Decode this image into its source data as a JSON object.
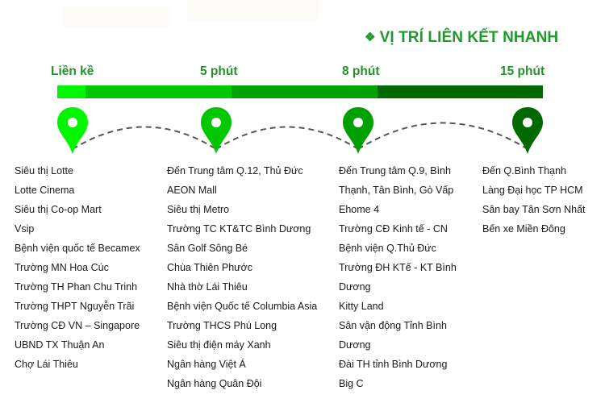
{
  "title": {
    "bullet": "❖",
    "text": "VỊ TRÍ LIÊN KẾT NHANH"
  },
  "colors": {
    "title": "#1f9a2a",
    "stage_1": "#00f500",
    "stage_2": "#00c800",
    "stage_3": "#00a400",
    "stage_4": "#006a00"
  },
  "timeline": {
    "stages": [
      {
        "label": "Liền kề",
        "pin_icon": "map-pin-icon"
      },
      {
        "label": "5 phút",
        "pin_icon": "map-pin-icon"
      },
      {
        "label": "8 phút",
        "pin_icon": "map-pin-icon"
      },
      {
        "label": "15 phút",
        "pin_icon": "map-pin-icon"
      }
    ]
  },
  "columns": [
    {
      "items": [
        "Siêu thị Lotte",
        "Lotte Cinema",
        "Siêu thị Co-op Mart",
        "Vsip",
        "Bệnh viện quốc tế Becamex",
        "Trường MN Hoa Cúc",
        "Trường TH Phan Chu Trinh",
        "Trường THPT Nguyễn Trãi",
        "Trường CĐ VN – Singapore",
        "UBND TX Thuận An",
        "Chợ Lái Thiêu"
      ]
    },
    {
      "items": [
        "Đến Trung tâm Q.12, Thủ Đức",
        "AEON Mall",
        "Siêu thị Metro",
        "Trường TC KT&TC Bình Dương",
        "Sân Golf Sông Bé",
        "Chùa Thiên Phước",
        "Nhà thờ Lái Thiêu",
        "Bệnh viện Quốc tế Columbia Asia",
        "Trường THCS Phú Long",
        "Siêu thị điện máy Xanh",
        "Ngân hàng Việt Á",
        "Ngân hàng Quân Đội"
      ]
    },
    {
      "items": [
        "Đến Trung tâm Q.9, Bình",
        "Thạnh, Tân Bình, Gò Vấp",
        "Ehome 4",
        "Trường CĐ Kinh tế - CN",
        "Bệnh viện Q.Thủ Đức",
        "Trường ĐH KTế - KT Bình",
        "Dương",
        "Kitty Land",
        "Sân vận động Tỉnh Bình",
        "Dương",
        "Đài TH tỉnh Bình Dương",
        "Big C"
      ]
    },
    {
      "items": [
        "Đến Q.Bình Thạnh",
        "Làng Đại học TP HCM",
        "Sân bay Tân Sơn Nhất",
        "Bến xe Miền Đông"
      ]
    }
  ]
}
